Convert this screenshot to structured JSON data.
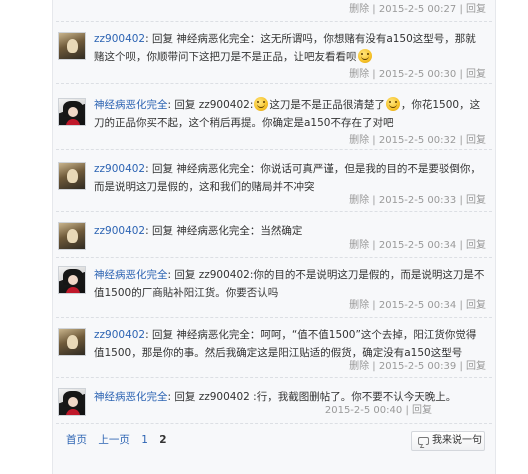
{
  "labels": {
    "delete": "删除",
    "reply": "回复"
  },
  "replies": [
    {
      "avatar": "a1",
      "user": "",
      "text": "",
      "time": "2015-2-5 00:27",
      "show_delete": true
    },
    {
      "avatar": "a1",
      "user": "zz900402",
      "text_parts": [
        ": 回复 神经病恶化完全：这无所谓吗，你想赌有没有a150这型号，那就赌这个呗，你顺带问下这把刀是不是正品，让吧友看看呗"
      ],
      "emoji_end": true,
      "time": "2015-2-5 00:30",
      "show_delete": true
    },
    {
      "avatar": "a2",
      "user": "神经病恶化完全",
      "text_parts": [
        ": 回复 zz900402:",
        "这刀是不是正品很清楚了",
        "，你花1500，这刀的正品你买不起，这个稍后再提。你确定是a150不存在了对吧"
      ],
      "time": "2015-2-5 00:32",
      "show_delete": true
    },
    {
      "avatar": "a1",
      "user": "zz900402",
      "text_parts": [
        ": 回复 神经病恶化完全：你说话可真严谨，但是我的目的不是要驳倒你，而是说明这刀是假的，这和我们的赌局并不冲突"
      ],
      "time": "2015-2-5 00:33",
      "show_delete": true
    },
    {
      "avatar": "a1",
      "user": "zz900402",
      "text_parts": [
        ": 回复 神经病恶化完全：当然确定"
      ],
      "time": "2015-2-5 00:34",
      "show_delete": true
    },
    {
      "avatar": "a2",
      "user": "神经病恶化完全",
      "text_parts": [
        ": 回复 zz900402:你的目的不是说明这刀是假的，而是说明这刀是不值1500的厂商貼补阳江货。你要否认吗"
      ],
      "time": "2015-2-5 00:34",
      "show_delete": true
    },
    {
      "avatar": "a1",
      "user": "zz900402",
      "text_parts": [
        ": 回复 神经病恶化完全：呵呵，“值不值1500”这个去掉，阳江货你觉得值1500，那是你的事。然后我确定这是阳江贴适的假货，确定没有a150这型号"
      ],
      "time": "2015-2-5 00:39",
      "show_delete": true
    },
    {
      "avatar": "a2",
      "user": "神经病恶化完全",
      "text_parts": [
        ": 回复 zz900402 :行，我截图删帖了。你不要不认今天晚上。"
      ],
      "time": "2015-2-5 00:40",
      "show_delete": false
    }
  ],
  "pager": {
    "first": "首页",
    "prev": "上一页",
    "page1": "1",
    "page2": "2"
  },
  "say_button": "我来说一句"
}
